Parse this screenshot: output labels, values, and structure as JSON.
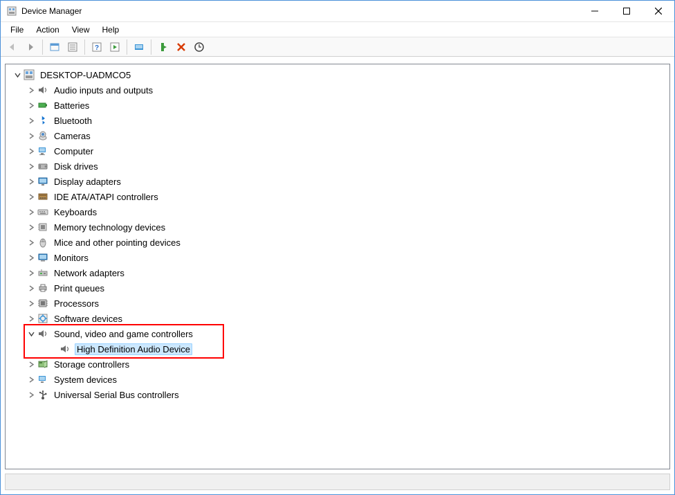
{
  "window": {
    "title": "Device Manager"
  },
  "menu": {
    "file": "File",
    "action": "Action",
    "view": "View",
    "help": "Help"
  },
  "tree": {
    "root": "DESKTOP-UADMCO5",
    "categories": [
      {
        "label": "Audio inputs and outputs",
        "icon": "speaker"
      },
      {
        "label": "Batteries",
        "icon": "battery"
      },
      {
        "label": "Bluetooth",
        "icon": "bluetooth"
      },
      {
        "label": "Cameras",
        "icon": "camera"
      },
      {
        "label": "Computer",
        "icon": "computer"
      },
      {
        "label": "Disk drives",
        "icon": "disk"
      },
      {
        "label": "Display adapters",
        "icon": "display"
      },
      {
        "label": "IDE ATA/ATAPI controllers",
        "icon": "ide"
      },
      {
        "label": "Keyboards",
        "icon": "keyboard"
      },
      {
        "label": "Memory technology devices",
        "icon": "memory"
      },
      {
        "label": "Mice and other pointing devices",
        "icon": "mouse"
      },
      {
        "label": "Monitors",
        "icon": "monitor"
      },
      {
        "label": "Network adapters",
        "icon": "network"
      },
      {
        "label": "Print queues",
        "icon": "printer"
      },
      {
        "label": "Processors",
        "icon": "cpu"
      },
      {
        "label": "Software devices",
        "icon": "software"
      },
      {
        "label": "Sound, video and game controllers",
        "icon": "speaker",
        "expanded": true,
        "child": {
          "label": "High Definition Audio Device",
          "icon": "speaker",
          "selected": true
        }
      },
      {
        "label": "Storage controllers",
        "icon": "storage"
      },
      {
        "label": "System devices",
        "icon": "system"
      },
      {
        "label": "Universal Serial Bus controllers",
        "icon": "usb"
      }
    ]
  }
}
